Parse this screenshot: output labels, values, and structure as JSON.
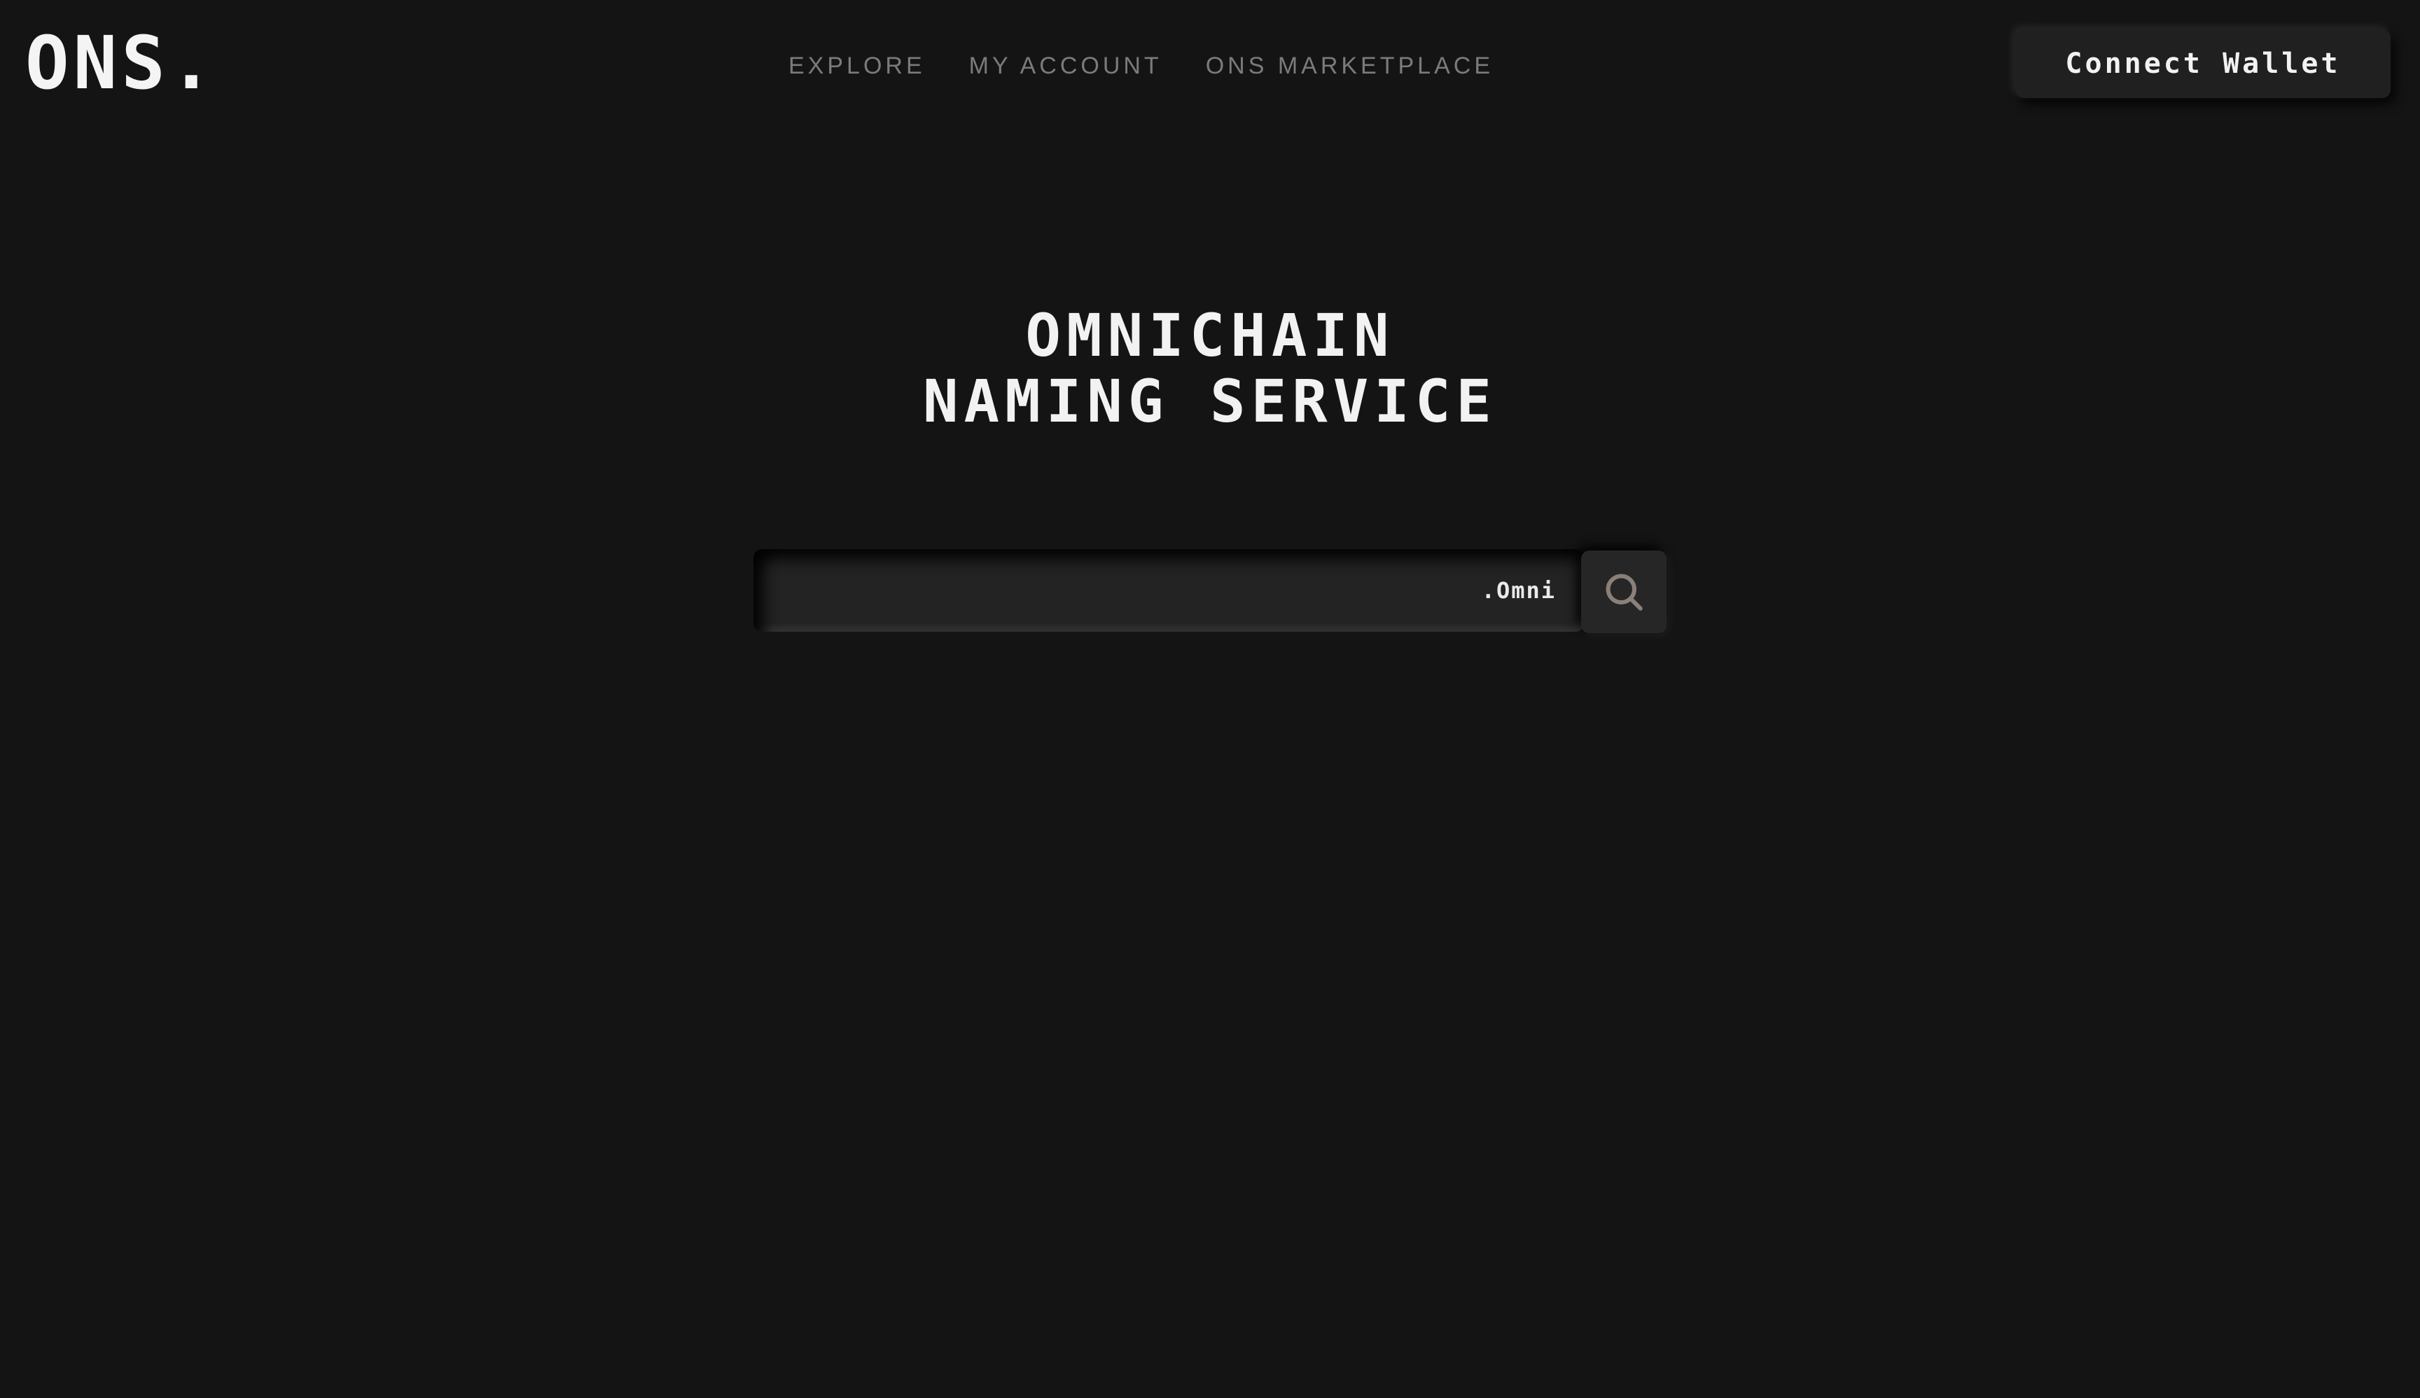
{
  "header": {
    "logo": "ONS.",
    "nav": [
      {
        "label": "EXPLORE"
      },
      {
        "label": "MY ACCOUNT"
      },
      {
        "label": "ONS MARKETPLACE"
      }
    ],
    "connect_label": "Connect Wallet"
  },
  "hero": {
    "title_line1": "OMNICHAIN",
    "title_line2": "NAMING SERVICE"
  },
  "search": {
    "value": "",
    "placeholder": "",
    "suffix": ".Omni",
    "icon": "search-icon"
  },
  "colors": {
    "background": "#141414",
    "nav_text": "#7b7b7b",
    "text": "#f2f2f2",
    "search_icon": "#8a8079"
  }
}
